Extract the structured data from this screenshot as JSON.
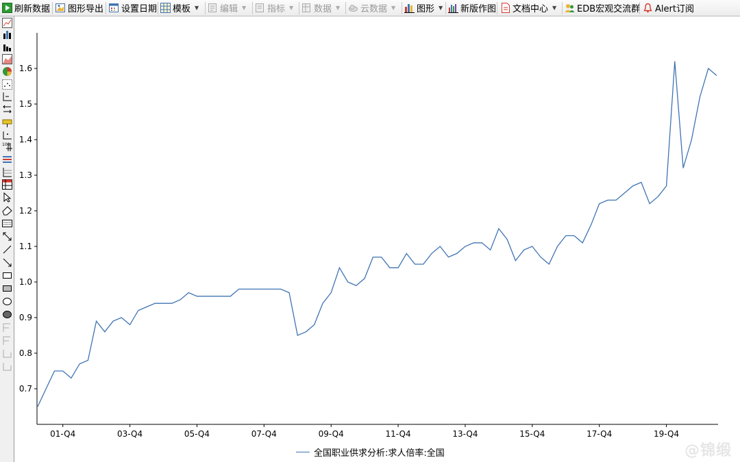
{
  "toolbar": {
    "refresh": "刷新数据",
    "export": "图形导出",
    "set_date": "设置日期",
    "template": "模板",
    "edit": "编辑",
    "indicator": "指标",
    "data": "数据",
    "cloud_data": "云数据",
    "graph": "图形",
    "new_chart": "新版作图",
    "doc_center": "文档中心",
    "edb_group": "EDB宏观交流群",
    "alert": "Alert订阅"
  },
  "watermark": "@锦缎",
  "colors": {
    "series": "#3f73b3",
    "accent_green": "#2e9a35",
    "alert_red": "#d23a2f"
  },
  "chart_data": {
    "type": "line",
    "xlabel": "",
    "ylabel": "",
    "ylim": [
      0.6,
      1.7
    ],
    "yticks": [
      "0.7",
      "0.8",
      "0.9",
      "1.0",
      "1.1",
      "1.2",
      "1.3",
      "1.4",
      "1.5",
      "1.6"
    ],
    "xticks": [
      "01-Q4",
      "03-Q4",
      "05-Q4",
      "07-Q4",
      "09-Q4",
      "11-Q4",
      "13-Q4",
      "15-Q4",
      "17-Q4",
      "19-Q4"
    ],
    "grid": false,
    "legend_position": "bottom-center",
    "series": [
      {
        "name": "全国职业供求分析:求人倍率:全国",
        "values": [
          0.65,
          0.7,
          0.75,
          0.75,
          0.73,
          0.77,
          0.78,
          0.89,
          0.86,
          0.89,
          0.9,
          0.88,
          0.92,
          0.93,
          0.94,
          0.94,
          0.94,
          0.95,
          0.97,
          0.96,
          0.96,
          0.96,
          0.96,
          0.96,
          0.98,
          0.98,
          0.98,
          0.98,
          0.98,
          0.98,
          0.97,
          0.85,
          0.86,
          0.88,
          0.94,
          0.97,
          1.04,
          1.0,
          0.99,
          1.01,
          1.07,
          1.07,
          1.04,
          1.04,
          1.08,
          1.05,
          1.05,
          1.08,
          1.1,
          1.07,
          1.08,
          1.1,
          1.11,
          1.11,
          1.09,
          1.15,
          1.12,
          1.06,
          1.09,
          1.1,
          1.07,
          1.05,
          1.1,
          1.13,
          1.13,
          1.11,
          1.16,
          1.22,
          1.23,
          1.23,
          1.25,
          1.27,
          1.28,
          1.22,
          1.24,
          1.27,
          1.62,
          1.32,
          1.4,
          1.52,
          1.6,
          1.58
        ]
      }
    ]
  }
}
